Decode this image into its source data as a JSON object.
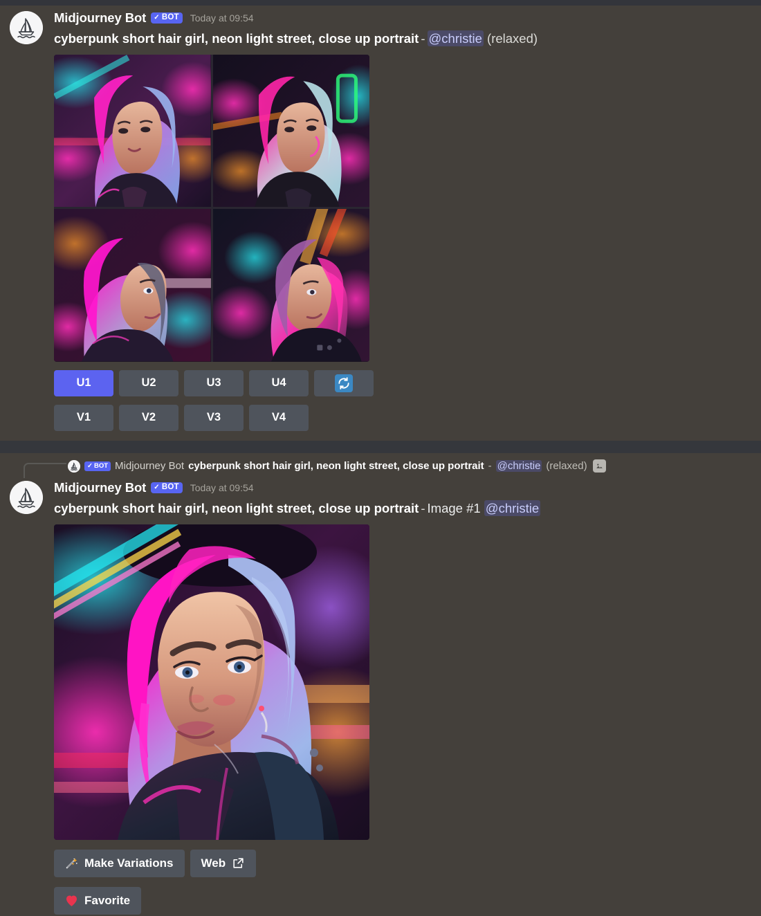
{
  "theme": {
    "background": "#44403b",
    "top_strip": "#33353b",
    "divider_band": "#35373c",
    "button_grey": "#4f545c",
    "button_primary": "#5c63f0",
    "bot_badge": "#5865f2",
    "mention_bg": "#4b4a67",
    "mention_text": "#c9cdfb",
    "refresh_blue": "#3b88c3",
    "timestamp_text": "#a6a39c"
  },
  "message_one": {
    "author": "Midjourney Bot",
    "bot_badge": "BOT",
    "bot_check": "✓",
    "timestamp": "Today at 09:54",
    "prompt": "cyberpunk short hair girl, neon light street, close up portrait",
    "separator": "-",
    "mention": "@christie",
    "mode": "(relaxed)",
    "avatar_icon": "midjourney-sailboat-icon",
    "grid_alt": "four-image-cyberpunk-portrait-grid",
    "upscale_buttons": [
      {
        "label": "U1",
        "primary": true
      },
      {
        "label": "U2",
        "primary": false
      },
      {
        "label": "U3",
        "primary": false
      },
      {
        "label": "U4",
        "primary": false
      }
    ],
    "reroll_button": {
      "label": "",
      "icon": "refresh-icon"
    },
    "variation_buttons": [
      {
        "label": "V1"
      },
      {
        "label": "V2"
      },
      {
        "label": "V3"
      },
      {
        "label": "V4"
      }
    ]
  },
  "reply_bar": {
    "author": "Midjourney Bot",
    "bot_badge": "BOT",
    "bot_check": "✓",
    "prompt": "cyberpunk short hair girl, neon light street, close up portrait",
    "separator": "-",
    "mention": "@christie",
    "mode": "(relaxed)",
    "attachment_icon": "image-attachment-icon"
  },
  "message_two": {
    "author": "Midjourney Bot",
    "bot_badge": "BOT",
    "bot_check": "✓",
    "timestamp": "Today at 09:54",
    "prompt": "cyberpunk short hair girl, neon light street, close up portrait",
    "separator": "-",
    "image_label": "Image #1",
    "mention": "@christie",
    "avatar_icon": "midjourney-sailboat-icon",
    "image_alt": "upscaled-cyberpunk-portrait",
    "actions": [
      {
        "label": "Make Variations",
        "icon": "magic-wand-icon",
        "emoji": "🪄"
      },
      {
        "label": "Web",
        "icon": "external-link-icon",
        "emoji": ""
      },
      {
        "label": "Favorite",
        "icon": "heart-icon",
        "emoji": "❤️"
      }
    ]
  }
}
